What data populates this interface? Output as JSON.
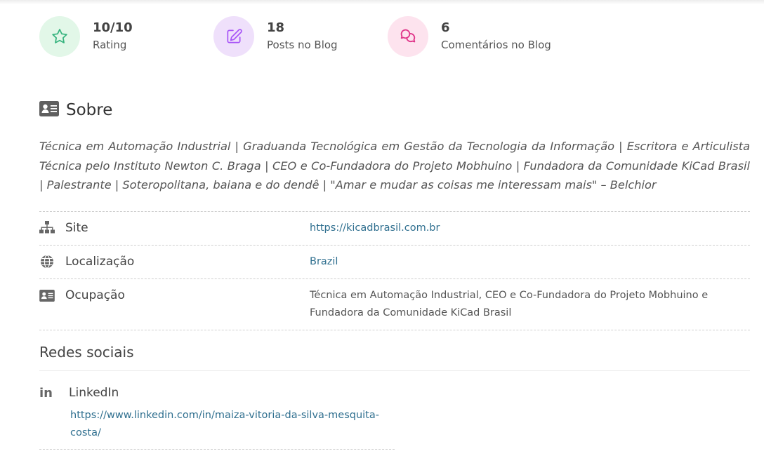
{
  "stats": [
    {
      "value": "10/10",
      "label": "Rating",
      "icon": "star-icon",
      "color": "#36b37e",
      "bg": "#e2f7e8"
    },
    {
      "value": "18",
      "label": "Posts no Blog",
      "icon": "edit-icon",
      "color": "#a855f7",
      "bg": "#efe0fb"
    },
    {
      "value": "6",
      "label": "Comentários no Blog",
      "icon": "chat-icon",
      "color": "#e0368a",
      "bg": "#fde3ee"
    }
  ],
  "sobre": {
    "title": "Sobre",
    "bio": "Técnica em Automação Industrial | Graduanda Tecnológica em Gestão da Tecnologia da Informação | Escritora e Articulista Técnica pelo Instituto Newton C. Braga | CEO e Co-Fundadora do Projeto Mobhuino | Fundadora da Comunidade KiCad Brasil | Palestrante | Soteropolitana, baiana e do dendê | \"Amar e mudar as coisas me interessam mais\" –  Belchior"
  },
  "info": {
    "site_label": "Site",
    "site_value": "https://kicadbrasil.com.br",
    "location_label": "Localização",
    "location_value": "Brazil",
    "occupation_label": "Ocupação",
    "occupation_value": "Técnica em Automação Industrial, CEO e Co-Fundadora do Projeto Mobhuino e Fundadora da Comunidade KiCad Brasil"
  },
  "redes": {
    "title": "Redes sociais",
    "linkedin_icon": "in",
    "linkedin_label": "LinkedIn",
    "linkedin_url": "https://www.linkedin.com/in/maiza-vitoria-da-silva-mesquita-costa/"
  }
}
